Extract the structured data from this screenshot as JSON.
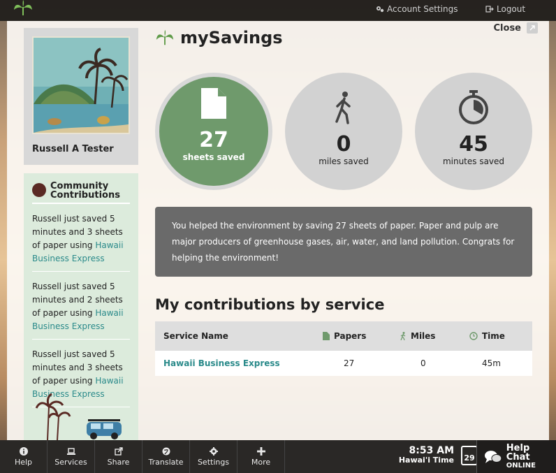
{
  "header": {
    "account_settings": "Account Settings",
    "logout": "Logout"
  },
  "panel": {
    "close_label": "Close"
  },
  "profile": {
    "name": "Russell A Tester"
  },
  "community": {
    "title_line1": "Community",
    "title_line2": "Contributions",
    "entries": [
      {
        "text": "Russell just saved 5 minutes and 3 sheets of paper using ",
        "service": "Hawaii Business Express"
      },
      {
        "text": "Russell just saved 5 minutes and 2 sheets of paper using ",
        "service": "Hawaii Business Express"
      },
      {
        "text": "Russell just saved 5 minutes and 3 sheets of paper using ",
        "service": "Hawaii Business Express"
      }
    ]
  },
  "main": {
    "title": "mySavings",
    "stats": [
      {
        "value": "27",
        "label": "sheets saved",
        "icon": "document-icon"
      },
      {
        "value": "0",
        "label": "miles saved",
        "icon": "walking-icon"
      },
      {
        "value": "45",
        "label": "minutes saved",
        "icon": "stopwatch-icon"
      }
    ],
    "message": "You helped the environment by saving 27 sheets of paper. Paper and pulp are major producers of greenhouse gases, air, water, and land pollution. Congrats for helping the environment!",
    "section_title": "My contributions by service",
    "table": {
      "headers": [
        "Service Name",
        "Papers",
        "Miles",
        "Time"
      ],
      "rows": [
        [
          "Hawaii Business Express",
          "27",
          "0",
          "45m"
        ]
      ]
    }
  },
  "bottombar": {
    "items": [
      "Help",
      "Services",
      "Share",
      "Translate",
      "Settings",
      "More"
    ],
    "time": "8:53 AM",
    "zone": "Hawai'i Time",
    "date": "29",
    "help_chat_line1": "Help Chat",
    "help_chat_line2": "ONLINE"
  },
  "colors": {
    "accent_green": "#6f9a6c",
    "link_teal": "#2a8a8a",
    "message_bg": "#6a6a6a"
  }
}
